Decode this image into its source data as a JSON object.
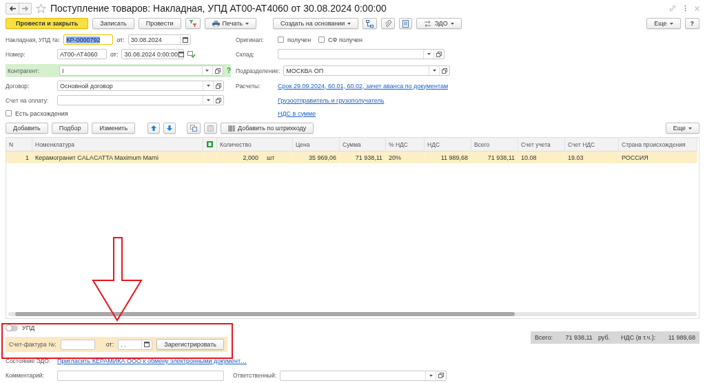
{
  "window": {
    "title": "Поступление товаров: Накладная, УПД АТ00-АТ4060 от 30.08.2024 0:00:00"
  },
  "toolbar": {
    "post_close": "Провести и закрыть",
    "save": "Записать",
    "post": "Провести",
    "print": "Печать",
    "create_based": "Создать на основании",
    "edo": "ЭДО",
    "more": "Еще",
    "help": "?"
  },
  "document": {
    "label": "Накладная, УПД №:",
    "value": "КР-0000792",
    "focused": true,
    "date_label": "от:",
    "date": "30.08.2024"
  },
  "number": {
    "label": "Номер:",
    "value": "АТ00-АТ4060",
    "date_label": "от:",
    "date": "30.08.2024  0:00:00"
  },
  "counterparty": {
    "label": "Контрагент:",
    "value": "I",
    "highlighted": true,
    "help": "?"
  },
  "contract": {
    "label": "Договор:",
    "value": "Основной договор"
  },
  "payment_invoice": {
    "label": "Счет на оплату:"
  },
  "discrepancies": {
    "label": "Есть расхождения",
    "checked": false
  },
  "original": {
    "label": "Оригинал:",
    "options": [
      {
        "label": "получен",
        "checked": false
      },
      {
        "label": "СФ получен",
        "checked": false
      }
    ]
  },
  "warehouse": {
    "label": "Склад:"
  },
  "division": {
    "label": "Подразделение:",
    "value": "МОСКВА ОП"
  },
  "settlements": {
    "label": "Расчеты:",
    "link": "Срок 29.09.2024, 60.01, 60.02, зачет аванса по документам"
  },
  "links": [
    "Грузоотправитель и грузополучатель",
    "НДС в сумме"
  ],
  "table_toolbar": {
    "buttons": [
      "Добавить",
      "Подбор",
      "Изменить"
    ],
    "barcode_button": "Добавить по штрихкоду",
    "more": "Еще"
  },
  "table": {
    "columns": [
      {
        "label": "N"
      },
      {
        "label": "Номенклатура"
      },
      {
        "kind": "icon"
      },
      {
        "label": "Количество"
      },
      {
        "label": "Цена"
      },
      {
        "label": "Сумма"
      },
      {
        "label": "% НДС"
      },
      {
        "label": "НДС"
      },
      {
        "label": "Всего"
      },
      {
        "label": "Счет учета"
      },
      {
        "label": "Счет НДС"
      },
      {
        "label": "Страна происхождения"
      }
    ],
    "rows": [
      {
        "selected": true,
        "cells": [
          "1",
          "Керамогранит CALACATTA Maximum Marni",
          "",
          {
            "value": "2,000",
            "unit": "шт"
          },
          "35 969,06",
          "71 938,11",
          "20%",
          "11 989,68",
          "71 938,11",
          "10.08",
          "19.03",
          "РОССИЯ"
        ]
      }
    ]
  },
  "upd": {
    "label": "УПД",
    "on": false
  },
  "invoice": {
    "label": "Счет-фактура №:",
    "date_label": "от:",
    "date": " .  . ",
    "button": "Зарегистрировать"
  },
  "totals": {
    "total_label": "Всего:",
    "total": "71 938,11",
    "currency": "руб.",
    "vat_label": "НДС (в т.ч.):",
    "vat": "11 989,68"
  },
  "edo_status": {
    "label": "Состояние ЭДО:",
    "link": "Пригласить КЕРАМИКА ООО к обмену электронными документ…"
  },
  "comment": {
    "label": "Комментарий:"
  },
  "responsible": {
    "label": "Ответственный:"
  }
}
